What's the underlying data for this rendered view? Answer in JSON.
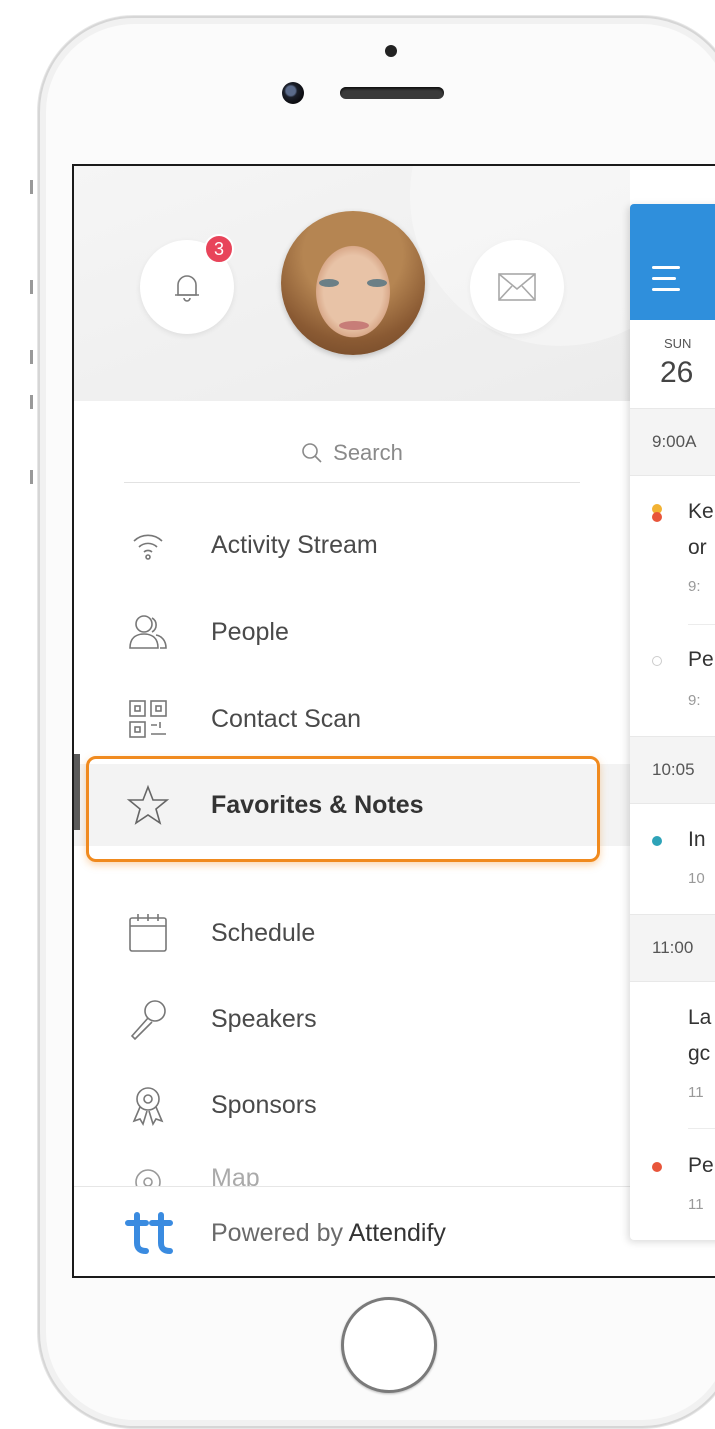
{
  "drawer": {
    "notification_count": "3",
    "search_placeholder": "Search",
    "menu": [
      {
        "label": "Activity Stream",
        "icon": "wifi-icon"
      },
      {
        "label": "People",
        "icon": "people-icon"
      },
      {
        "label": "Contact Scan",
        "icon": "qr-code-icon"
      },
      {
        "label": "Favorites & Notes",
        "icon": "star-icon",
        "active": true
      },
      {
        "label": "Schedule",
        "icon": "calendar-icon"
      },
      {
        "label": "Speakers",
        "icon": "microphone-icon"
      },
      {
        "label": "Sponsors",
        "icon": "award-icon"
      },
      {
        "label": "Map",
        "icon": "map-pin-icon"
      }
    ],
    "footer": {
      "powered_by": "Powered by",
      "brand": "Attendify",
      "logo": "tt"
    }
  },
  "schedule": {
    "day": "SUN",
    "date": "26",
    "times": [
      "9:00A",
      "10:05",
      "11:00"
    ],
    "events": [
      {
        "line1": "Ke",
        "line2": "or",
        "sub": "9:",
        "dot_colors": [
          "#f2b233",
          "#e8553a"
        ]
      },
      {
        "line1": "Pe",
        "sub": "9:",
        "dot_colors": [
          "#cccccc"
        ]
      },
      {
        "line1": "In",
        "sub": "10",
        "dot_colors": [
          "#2ea3b8"
        ]
      },
      {
        "line1": "La",
        "line2": "gc",
        "sub": "11"
      },
      {
        "line1": "Pe",
        "sub": "11",
        "dot_colors": [
          "#e8553a"
        ]
      }
    ]
  },
  "colors": {
    "accent_blue": "#2f8fdc",
    "badge_red": "#e8445a",
    "highlight_orange": "#f08a1e",
    "brand_blue": "#3a8be0"
  }
}
